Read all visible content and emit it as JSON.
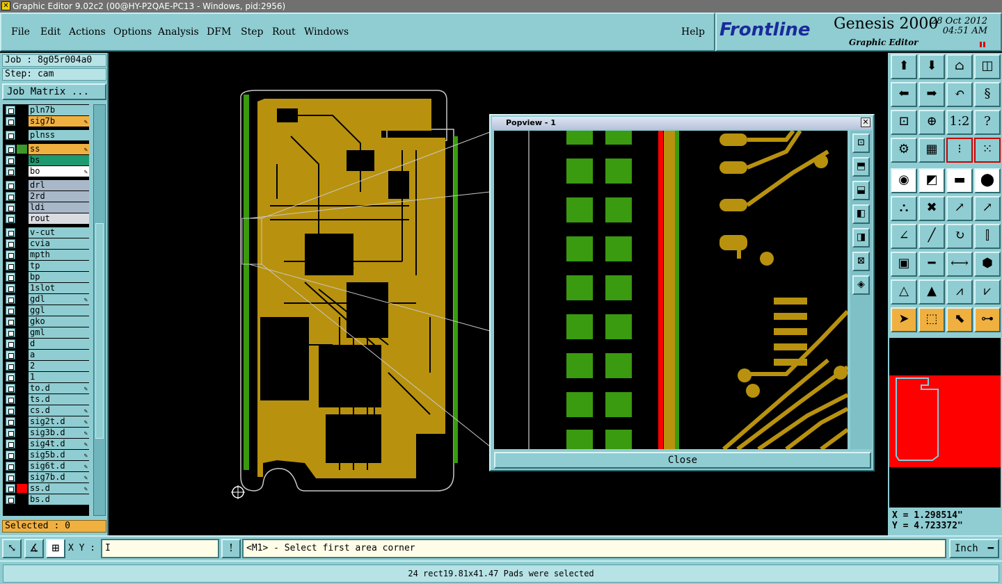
{
  "window": {
    "title": "Graphic Editor 9.02c2 (00@HY-P2QAE-PC13 - Windows, pid:2956)"
  },
  "menu": [
    "File",
    "Edit",
    "Actions",
    "Options",
    "Analysis",
    "DFM",
    "Step",
    "Rout",
    "Windows"
  ],
  "help_label": "Help",
  "brand": {
    "logo": "Frontline",
    "product": "Genesis 2000",
    "subtitle": "Graphic Editor",
    "date": "28 Oct 2012",
    "time": "04:51 AM"
  },
  "job": {
    "job_label": "Job : 8g05r004a0",
    "step_label": "Step: cam",
    "matrix_button": "Job Matrix ..."
  },
  "layers": [
    {
      "name": "pln7b",
      "color": "#000000",
      "bg": "#8fcdd2",
      "edit": false
    },
    {
      "name": "sig7b",
      "color": "#000000",
      "bg": "#f0b040",
      "edit": true
    },
    {
      "name": "plnss",
      "color": "#000000",
      "bg": "#8fcdd2",
      "edit": false
    },
    {
      "name": "ss",
      "color": "#3a9a2a",
      "bg": "#f0b040",
      "edit": true
    },
    {
      "name": "bs",
      "color": "#000000",
      "bg": "#1e9a70",
      "edit": false
    },
    {
      "name": "bo",
      "color": "#000000",
      "bg": "#ffffff",
      "edit": true
    },
    {
      "name": "drl",
      "color": "#000000",
      "bg": "#a8b8c8",
      "edit": false
    },
    {
      "name": "2rd",
      "color": "#000000",
      "bg": "#a8b8c8",
      "edit": false
    },
    {
      "name": "ldi",
      "color": "#000000",
      "bg": "#a8b8c8",
      "edit": false
    },
    {
      "name": "rout",
      "color": "#000000",
      "bg": "#d8dce0",
      "edit": false
    },
    {
      "name": "v-cut",
      "color": "#000000",
      "bg": "#8fcdd2",
      "edit": false
    },
    {
      "name": "cvia",
      "color": "#000000",
      "bg": "#8fcdd2",
      "edit": false
    },
    {
      "name": "mpth",
      "color": "#000000",
      "bg": "#8fcdd2",
      "edit": false
    },
    {
      "name": "tp",
      "color": "#000000",
      "bg": "#8fcdd2",
      "edit": false
    },
    {
      "name": "bp",
      "color": "#000000",
      "bg": "#8fcdd2",
      "edit": false
    },
    {
      "name": "1slot",
      "color": "#000000",
      "bg": "#8fcdd2",
      "edit": false
    },
    {
      "name": "gdl",
      "color": "#000000",
      "bg": "#8fcdd2",
      "edit": true
    },
    {
      "name": "ggl",
      "color": "#000000",
      "bg": "#8fcdd2",
      "edit": false
    },
    {
      "name": "gko",
      "color": "#000000",
      "bg": "#8fcdd2",
      "edit": false
    },
    {
      "name": "gml",
      "color": "#000000",
      "bg": "#8fcdd2",
      "edit": false
    },
    {
      "name": "d",
      "color": "#000000",
      "bg": "#8fcdd2",
      "edit": false
    },
    {
      "name": "a",
      "color": "#000000",
      "bg": "#8fcdd2",
      "edit": false
    },
    {
      "name": "2",
      "color": "#000000",
      "bg": "#8fcdd2",
      "edit": false
    },
    {
      "name": "1",
      "color": "#000000",
      "bg": "#8fcdd2",
      "edit": false
    },
    {
      "name": "to.d",
      "color": "#000000",
      "bg": "#8fcdd2",
      "edit": true
    },
    {
      "name": "ts.d",
      "color": "#000000",
      "bg": "#8fcdd2",
      "edit": false
    },
    {
      "name": "cs.d",
      "color": "#000000",
      "bg": "#8fcdd2",
      "edit": true
    },
    {
      "name": "sig2t.d",
      "color": "#000000",
      "bg": "#8fcdd2",
      "edit": true
    },
    {
      "name": "sig3b.d",
      "color": "#000000",
      "bg": "#8fcdd2",
      "edit": true
    },
    {
      "name": "sig4t.d",
      "color": "#000000",
      "bg": "#8fcdd2",
      "edit": true
    },
    {
      "name": "sig5b.d",
      "color": "#000000",
      "bg": "#8fcdd2",
      "edit": true
    },
    {
      "name": "sig6t.d",
      "color": "#000000",
      "bg": "#8fcdd2",
      "edit": true
    },
    {
      "name": "sig7b.d",
      "color": "#000000",
      "bg": "#8fcdd2",
      "edit": true
    },
    {
      "name": "ss.d",
      "color": "#ff0000",
      "bg": "#8fcdd2",
      "edit": true
    },
    {
      "name": "bs.d",
      "color": "#000000",
      "bg": "#8fcdd2",
      "edit": false
    }
  ],
  "selected_label": "Selected : 0",
  "popup": {
    "title": "Popview - 1",
    "close_label": "Close"
  },
  "coords": {
    "x": "X = 1.298514\"",
    "y": "Y = 4.723372\""
  },
  "bottom": {
    "xy_label": "X Y :",
    "prompt": "<M1> - Select first area corner",
    "unit": "Inch"
  },
  "status": "24 rect19.81x41.47 Pads were selected",
  "colors": {
    "panel": "#8fcdd2",
    "copper": "#b8920e",
    "pad_green": "#3a9a10",
    "selected_red": "#ff0000"
  }
}
